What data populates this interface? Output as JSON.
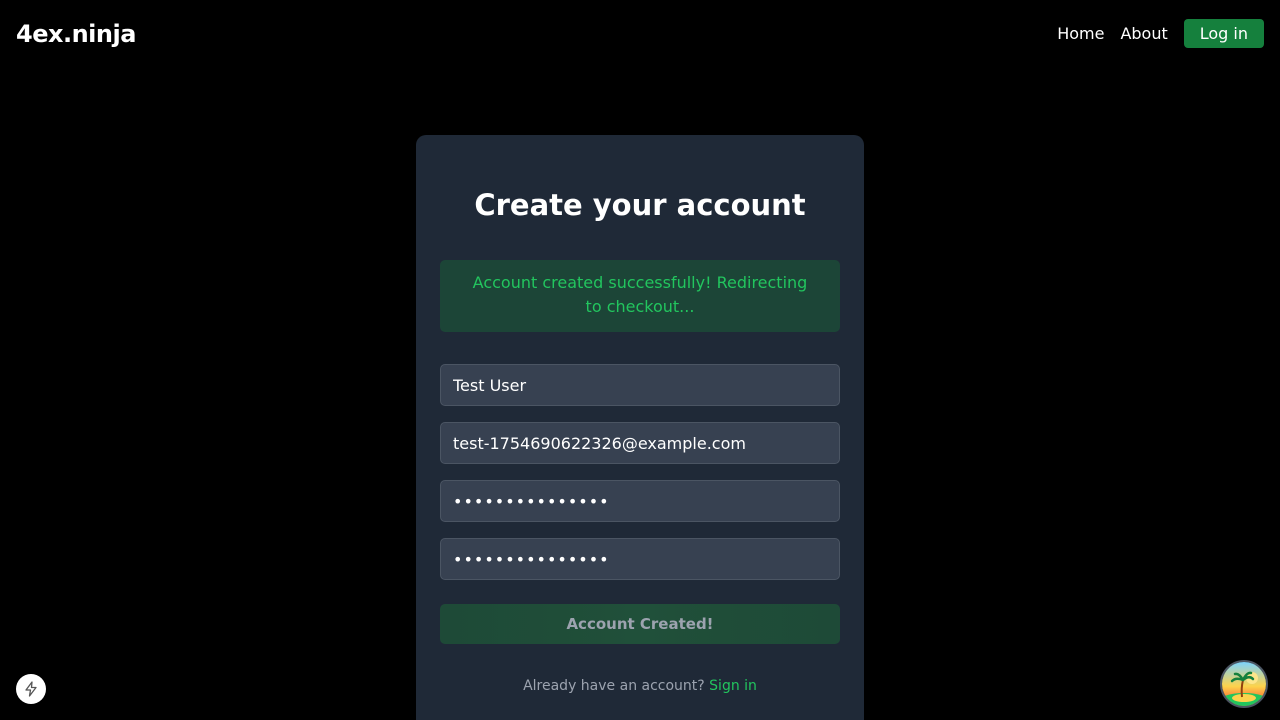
{
  "header": {
    "logo": "4ex.ninja",
    "nav": {
      "home": "Home",
      "about": "About",
      "login": "Log in"
    }
  },
  "card": {
    "title": "Create your account",
    "success_message": "Account created successfully! Redirecting to checkout...",
    "fields": {
      "name_value": "Test User",
      "email_value": "test-1754690622326@example.com",
      "password_value": "passwordpass123",
      "confirm_value": "passwordpass123"
    },
    "submit_label": "Account Created!",
    "signin_prompt": "Already have an account?",
    "signin_link": "Sign in"
  },
  "colors": {
    "background": "#000000",
    "card": "#1f2937",
    "accent_green": "#22c55e",
    "login_button": "#15803d"
  },
  "icons": {
    "bottom_left": "lightning-bolt-icon",
    "bottom_right": "island-avatar"
  }
}
